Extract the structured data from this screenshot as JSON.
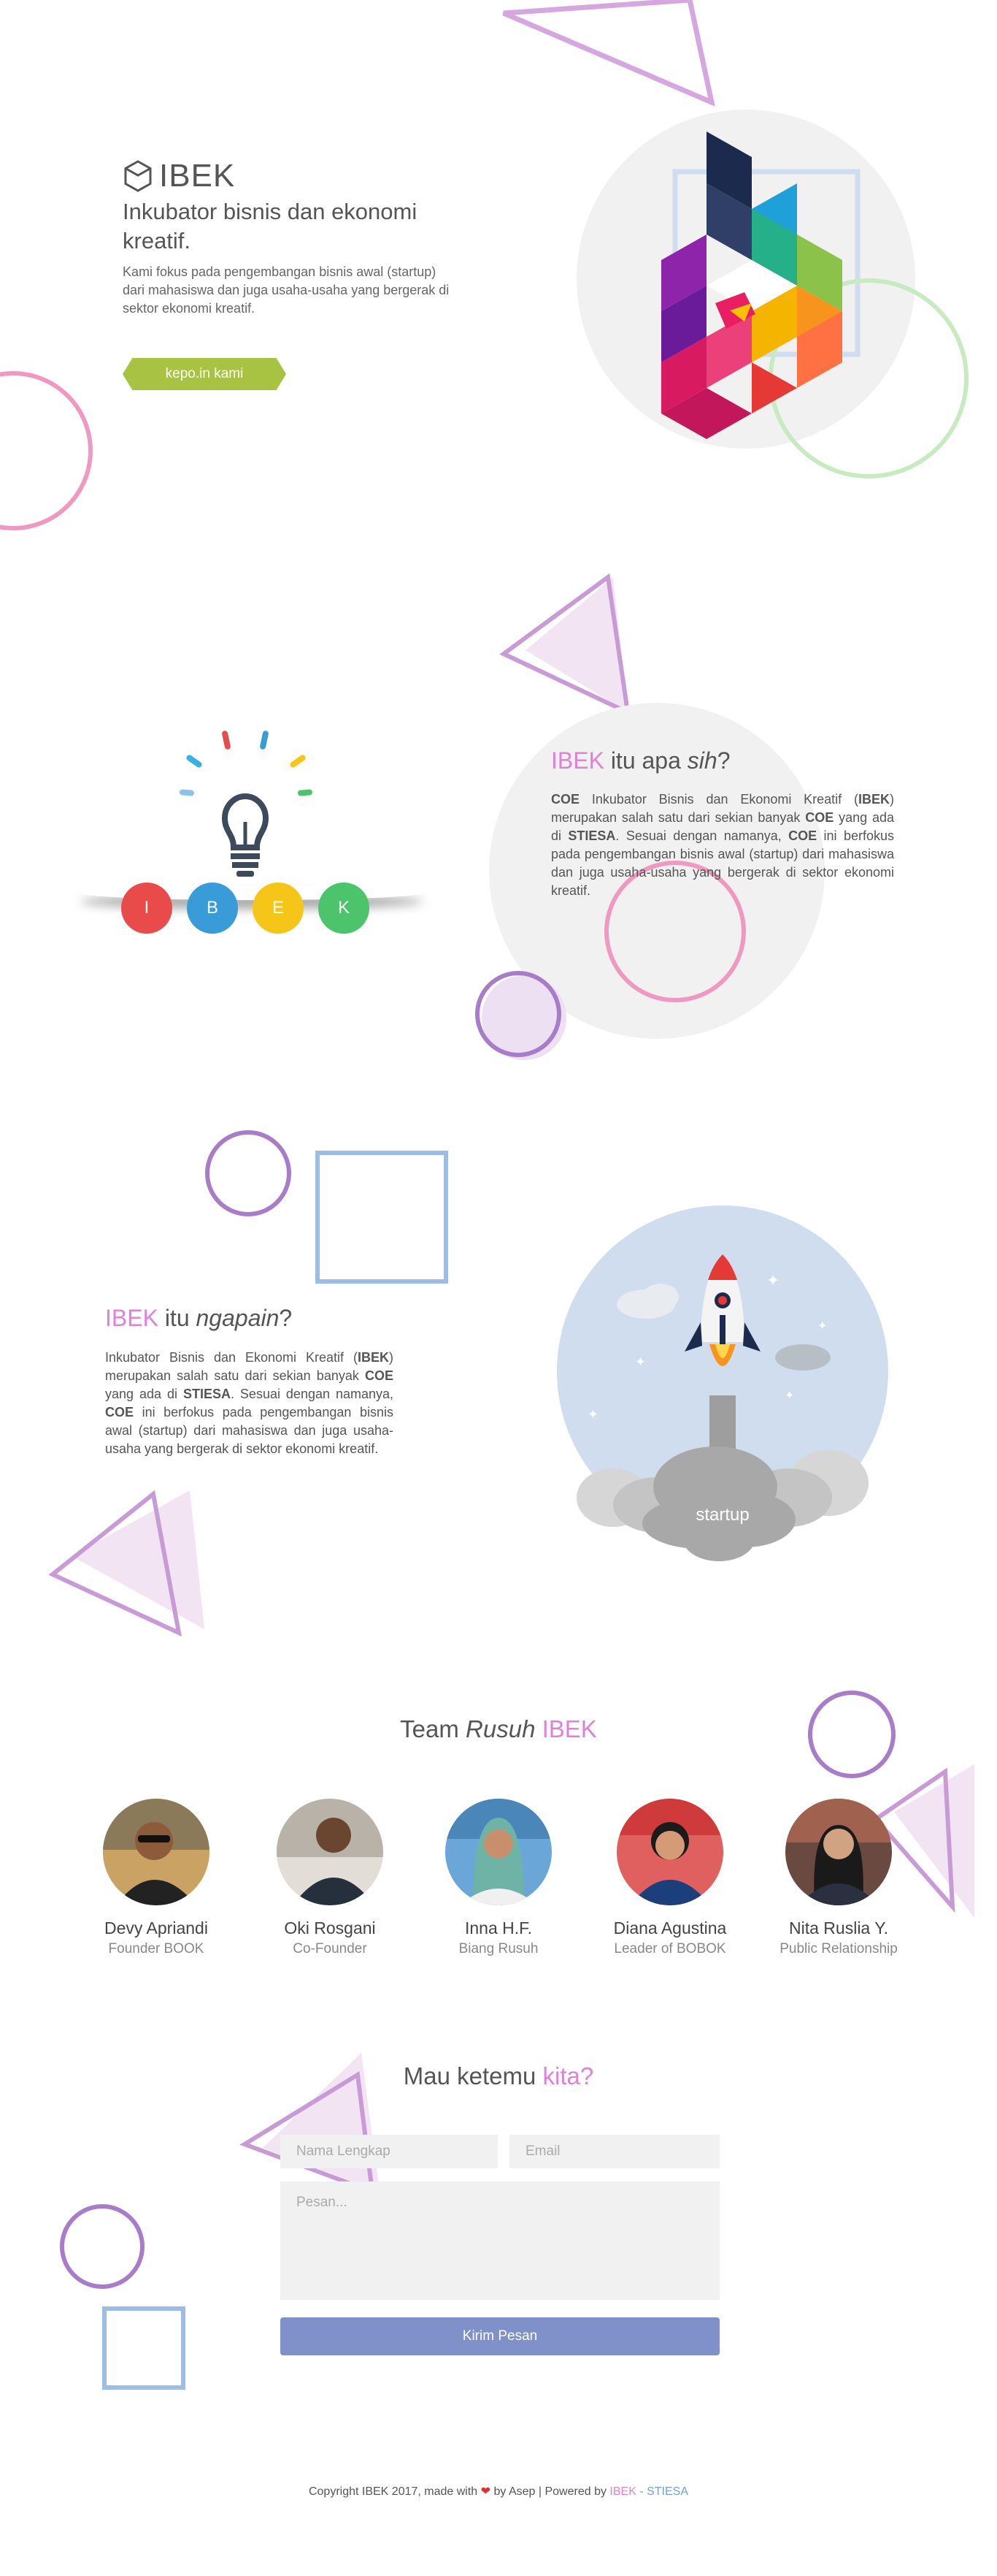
{
  "hero": {
    "brand": "IBEK",
    "title": "Inkubator bisnis dan ekonomi kreatif.",
    "description": "Kami fokus pada pengembangan bisnis awal (startup) dari mahasiswa dan juga usaha-usaha yang bergerak di sektor ekonomi kreatif.",
    "cta_label": "kepo.in kami"
  },
  "about": {
    "heading_accent": "IBEK",
    "heading_mid": " itu apa ",
    "heading_italic": "sih",
    "heading_end": "?",
    "p1": "COE",
    "p2": " Inkubator Bisnis dan Ekonomi Kreatif (",
    "p3": "IBEK",
    "p4": ") merupakan salah satu dari sekian banyak ",
    "p5": "COE",
    "p6": " yang ada di ",
    "p7": "STIESA",
    "p8": ". Sesuai dengan namanya, ",
    "p9": "COE",
    "p10": " ini berfokus pada pengembangan bisnis awal (startup) dari mahasiswa dan juga usaha-usaha yang bergerak di sektor ekonomi kreatif.",
    "letters": [
      "I",
      "B",
      "E",
      "K"
    ],
    "letter_colors": [
      "#e94b4b",
      "#3a9bd9",
      "#f5c518",
      "#4cc46b"
    ]
  },
  "what": {
    "heading_accent": "IBEK",
    "heading_mid": " itu ",
    "heading_italic": "ngapain",
    "heading_end": "?",
    "p1": "Inkubator Bisnis dan Ekonomi Kreatif (",
    "p2": "IBEK",
    "p3": ") merupakan salah satu dari sekian banyak ",
    "p4": "COE",
    "p5": " yang ada di ",
    "p6": "STIESA",
    "p7": ". Sesuai dengan namanya, ",
    "p8": "COE",
    "p9": " ini berfokus pada pengembangan bisnis awal (startup) dari mahasiswa dan juga usaha-usaha yang bergerak di sektor ekonomi kreatif.",
    "illustration_label": "startup"
  },
  "team": {
    "heading_start": "Team ",
    "heading_italic": "Rusuh",
    "heading_accent": " IBEK",
    "members": [
      {
        "name": "Devy Apriandi",
        "role": "Founder BOOK"
      },
      {
        "name": "Oki Rosgani",
        "role": "Co-Founder"
      },
      {
        "name": "Inna H.F.",
        "role": "Biang Rusuh"
      },
      {
        "name": "Diana Agustina",
        "role": "Leader of BOBOK"
      },
      {
        "name": "Nita Ruslia Y.",
        "role": "Public Relationship"
      }
    ]
  },
  "contact": {
    "heading_start": "Mau ketemu ",
    "heading_accent": "kita?",
    "name_placeholder": "Nama Lengkap",
    "email_placeholder": "Email",
    "message_placeholder": "Pesan...",
    "submit_label": "Kirim Pesan"
  },
  "footer": {
    "text_start": "Copyright IBEK 2017, made with ",
    "heart": "❤",
    "text_mid": " by Asep | Powered by ",
    "link_ibek": "IBEK",
    "sep": " - ",
    "link_stiesa": "STIESA"
  },
  "colors": {
    "accent_pink": "#e080d8",
    "button_green": "#a8c241",
    "button_blue": "#8090c8",
    "deco_purple": "#a87cc8",
    "deco_blue": "#9bbde6",
    "deco_pink": "#ef98c0",
    "deco_green": "#bfe6b0"
  }
}
